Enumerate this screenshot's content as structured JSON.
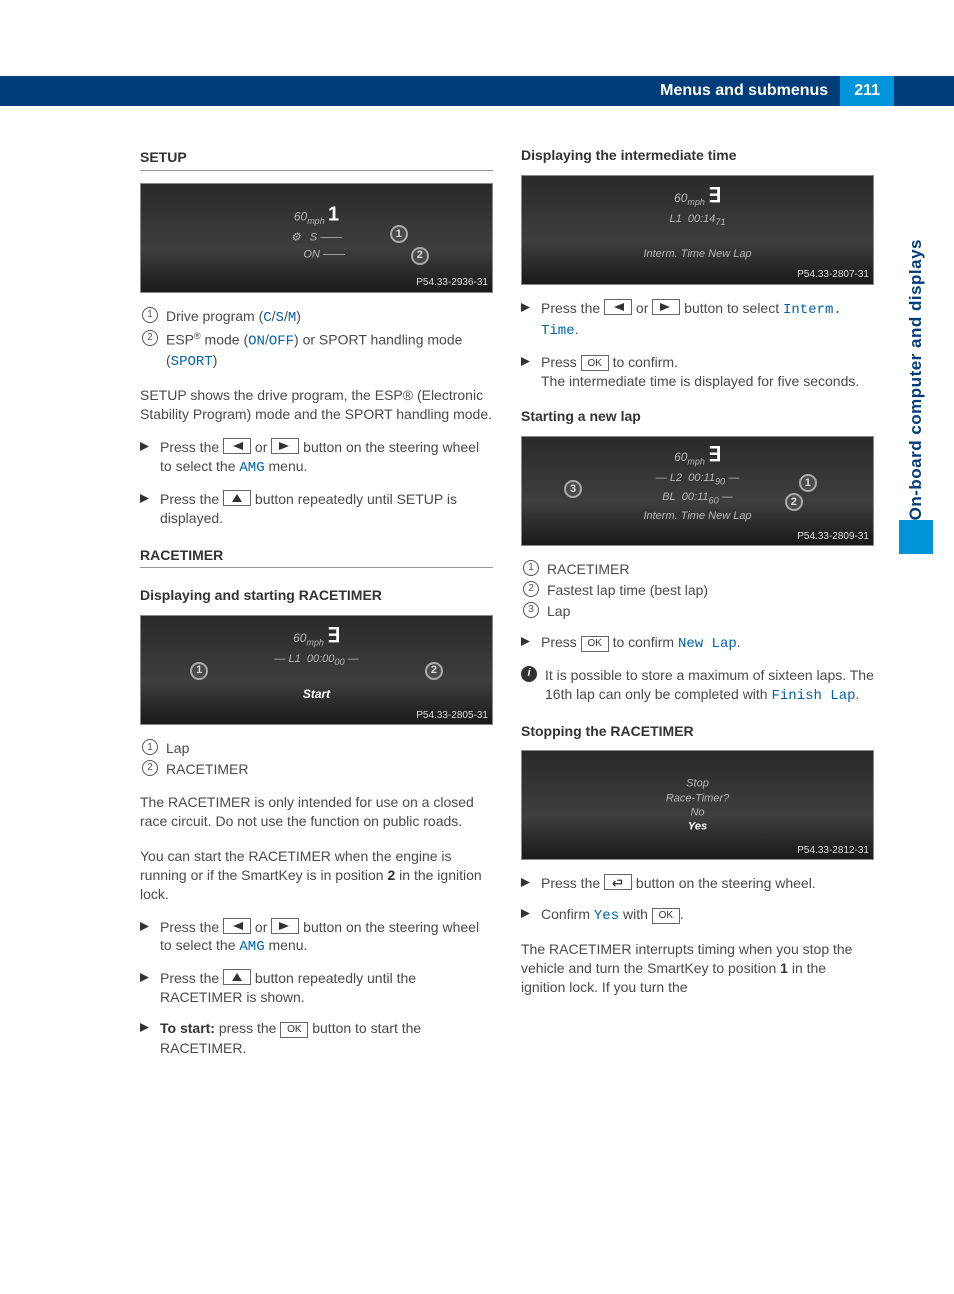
{
  "header": {
    "title": "Menus and submenus",
    "page": "211"
  },
  "sideTab": {
    "label": "On-board computer and displays"
  },
  "imgTags": {
    "setup": "P54.33-2936-31",
    "racetimer1": "P54.33-2805-31",
    "interm": "P54.33-2807-31",
    "newlap": "P54.33-2809-31",
    "stop": "P54.33-2812-31"
  },
  "displays": {
    "setup_speed": "60",
    "setup_unit": "mph",
    "setup_s": "S",
    "setup_on": "ON",
    "rt1_l1": "L1",
    "rt1_time": "00:00",
    "rt1_start": "Start",
    "interm_l1": "L1",
    "interm_time": "00:14",
    "interm_row": "Interm. Time   New Lap",
    "new_l2": "L2",
    "new_t2": "00:11",
    "new_bl": "BL",
    "new_tbl": "00:11",
    "new_row": "Interm. Time   New Lap",
    "stop_l1": "Stop",
    "stop_l2": "Race-Timer?",
    "stop_l3": "No",
    "stop_l4": "Yes"
  },
  "left": {
    "setup_title": "SETUP",
    "legend1_a": "Drive program (",
    "legend1_c": "C",
    "legend1_s": "S",
    "legend1_m": "M",
    "legend1_b": ")",
    "legend2_a": "ESP",
    "legend2_b": " mode (",
    "legend2_on": "ON",
    "legend2_off": "OFF",
    "legend2_c": ") or SPORT handling mode (",
    "legend2_sport": "SPORT",
    "legend2_d": ")",
    "setup_desc": "SETUP shows the drive program, the ESP® (Electronic Stability Program) mode and the SPORT handling mode.",
    "setup_step1_a": "Press the ",
    "setup_step1_b": " or ",
    "setup_step1_c": " button on the steering wheel to select the ",
    "setup_step1_amg": "AMG",
    "setup_step1_d": " menu.",
    "setup_step2_a": "Press the ",
    "setup_step2_b": " button repeatedly until SETUP is displayed.",
    "racetimer_title": "RACETIMER",
    "rt_sub1": "Displaying and starting RACETIMER",
    "rt_leg1": "Lap",
    "rt_leg2": "RACETIMER",
    "rt_p1": "The RACETIMER is only intended for use on a closed race circuit. Do not use the function on public roads.",
    "rt_p2_a": "You can start the RACETIMER when the engine is running or if the SmartKey is in position ",
    "rt_p2_b": "2",
    "rt_p2_c": " in the ignition lock.",
    "rt_step1_a": "Press the ",
    "rt_step1_b": " or ",
    "rt_step1_c": " button on the steering wheel to select the ",
    "rt_step1_amg": "AMG",
    "rt_step1_d": " menu.",
    "rt_step2_a": "Press the ",
    "rt_step2_b": " button repeatedly until the RACETIMER is shown.",
    "rt_step3_a": "To start:",
    "rt_step3_b": " press the ",
    "rt_step3_c": " button to start the RACETIMER."
  },
  "right": {
    "interm_title": "Displaying the intermediate time",
    "interm_step1_a": "Press the ",
    "interm_step1_b": " or ",
    "interm_step1_c": " button to select ",
    "interm_step1_d": "Interm. Time",
    "interm_step1_e": ".",
    "interm_step2_a": "Press ",
    "interm_step2_b": " to confirm.",
    "interm_step2_c": "The intermediate time is displayed for five seconds.",
    "newlap_title": "Starting a new lap",
    "newlap_leg1": "RACETIMER",
    "newlap_leg2": "Fastest lap time (best lap)",
    "newlap_leg3": "Lap",
    "newlap_step1_a": "Press ",
    "newlap_step1_b": " to confirm ",
    "newlap_step1_c": "New Lap",
    "newlap_step1_d": ".",
    "newlap_info_a": "It is possible to store a maximum of sixteen laps. The 16th lap can only be completed with ",
    "newlap_info_b": "Finish Lap",
    "newlap_info_c": ".",
    "stop_title": "Stopping the RACETIMER",
    "stop_step1_a": "Press the ",
    "stop_step1_b": " button on the steering wheel.",
    "stop_step2_a": "Confirm ",
    "stop_step2_b": "Yes",
    "stop_step2_c": " with ",
    "stop_step2_d": ".",
    "stop_p_a": "The RACETIMER interrupts timing when you stop the vehicle and turn the SmartKey to position ",
    "stop_p_b": "1",
    "stop_p_c": " in the ignition lock. If you turn the"
  },
  "keys": {
    "ok": "OK"
  }
}
